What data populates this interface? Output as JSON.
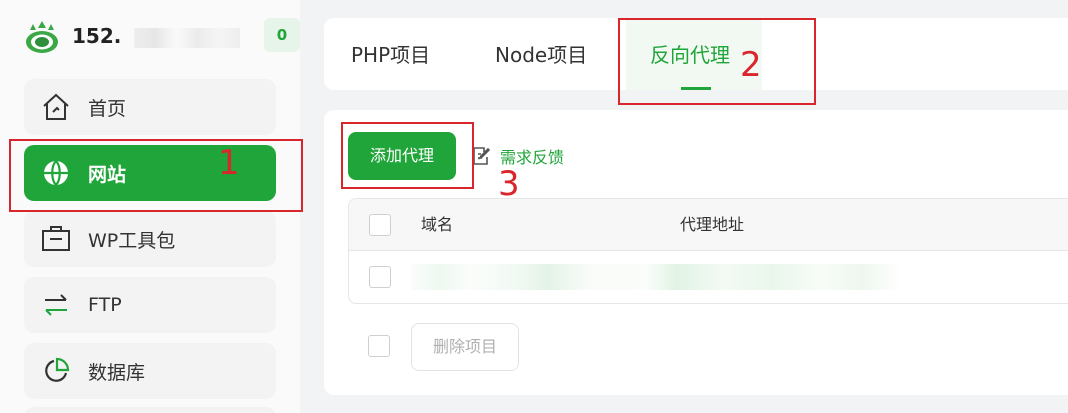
{
  "header": {
    "ip_label": "152.",
    "badge_count": "0"
  },
  "sidebar": {
    "items": [
      {
        "label": "首页",
        "icon": "home-icon"
      },
      {
        "label": "网站",
        "icon": "globe-icon",
        "active": true
      },
      {
        "label": "WP工具包",
        "icon": "toolbox-icon"
      },
      {
        "label": "FTP",
        "icon": "transfer-arrows-icon"
      },
      {
        "label": "数据库",
        "icon": "database-pie-icon"
      }
    ]
  },
  "tabs": [
    {
      "label": "PHP项目"
    },
    {
      "label": "Node项目"
    },
    {
      "label": "反向代理",
      "active": true
    }
  ],
  "toolbar": {
    "add_proxy_label": "添加代理",
    "feedback_label": "需求反馈"
  },
  "table": {
    "columns": [
      "域名",
      "代理地址"
    ]
  },
  "footer": {
    "delete_label": "删除项目"
  },
  "annotations": [
    "1",
    "2",
    "3"
  ],
  "colors": {
    "accent": "#20a53a",
    "annotation": "#d9262c"
  }
}
